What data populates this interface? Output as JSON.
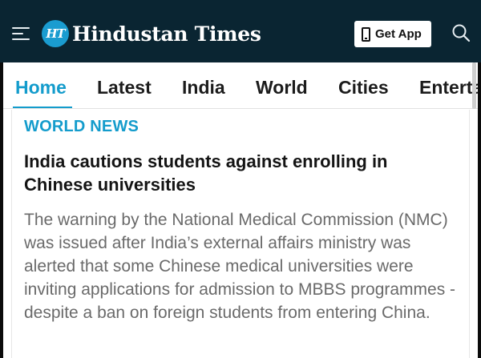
{
  "header": {
    "logo_badge": "HT",
    "logo_text": "Hindustan Times",
    "get_app_label": "Get App",
    "icons": [
      "menu-icon",
      "logo-icon",
      "phone-icon",
      "search-icon"
    ],
    "background_color": "#0a2532",
    "accent_color": "#149ccc"
  },
  "nav": {
    "tabs": [
      {
        "label": "Home",
        "active": true
      },
      {
        "label": "Latest",
        "active": false
      },
      {
        "label": "India",
        "active": false
      },
      {
        "label": "World",
        "active": false
      },
      {
        "label": "Cities",
        "active": false
      },
      {
        "label": "Enterta",
        "active": false
      }
    ]
  },
  "article": {
    "section": "WORLD NEWS",
    "headline": "India cautions students against enrolling in Chinese universities",
    "summary": "The warning by the National Medical Commission (NMC) was issued after India’s external affairs ministry was alerted that some Chinese medical universities were inviting applications for admission to MBBS programmes - despite a ban on foreign students from entering China."
  }
}
